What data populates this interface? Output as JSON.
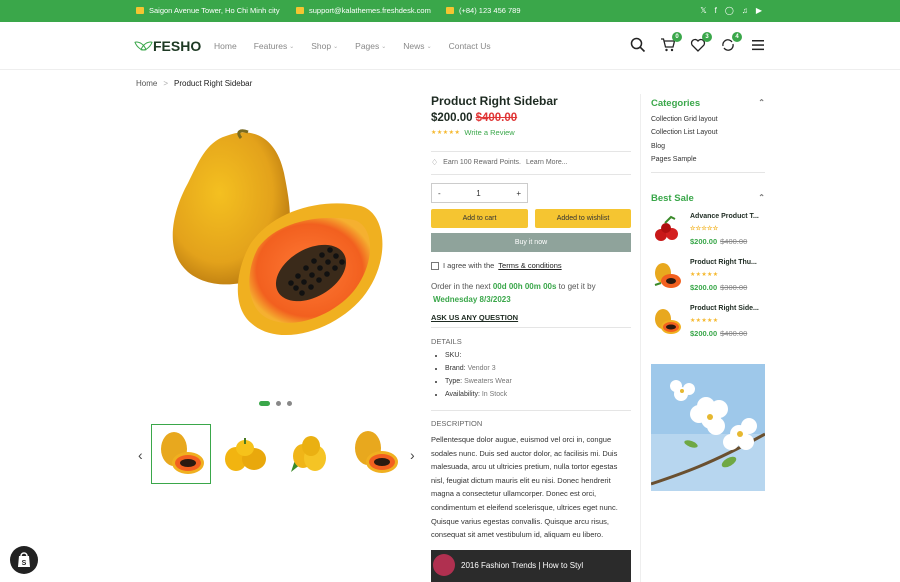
{
  "topbar": {
    "address": "Saigon Avenue Tower, Ho Chi Minh city",
    "email": "support@kalathemes.freshdesk.com",
    "phone": "(+84) 123 456 789",
    "social": [
      "twitter-icon",
      "facebook-icon",
      "instagram-icon",
      "tiktok-icon",
      "youtube-icon"
    ],
    "bg_color": "#3aa74a"
  },
  "header": {
    "logo": "FESHO",
    "nav": [
      {
        "label": "Home",
        "dropdown": false
      },
      {
        "label": "Features",
        "dropdown": true
      },
      {
        "label": "Shop",
        "dropdown": true
      },
      {
        "label": "Pages",
        "dropdown": true
      },
      {
        "label": "News",
        "dropdown": true
      },
      {
        "label": "Contact Us",
        "dropdown": false
      }
    ],
    "cart_count": "0",
    "wishlist_count": "3",
    "compare_count": "4"
  },
  "breadcrumb": {
    "home": "Home",
    "sep": ">",
    "current": "Product Right Sidebar"
  },
  "product": {
    "title": "Product Right Sidebar",
    "price": "$200.00",
    "old_price": "$400.00",
    "rating": 5,
    "review_link": "Write a Review",
    "reward": "Earn 100 Reward Points.",
    "learn_more": "Learn More...",
    "qty_minus": "-",
    "qty": "1",
    "qty_plus": "+",
    "add_to_cart": "Add to cart",
    "add_to_wishlist": "Added to wishlist",
    "buy_now": "Buy it now",
    "agree_text": "I agree with the",
    "terms": "Terms & conditions",
    "order_prefix": "Order in the next",
    "countdown": "00d 00h 00m 00s",
    "order_mid": "to get it by",
    "delivery_date": "Wednesday 8/3/2023",
    "ask": "ASK US ANY QUESTION",
    "details_title": "DETAILS",
    "details": [
      {
        "label": "SKU:",
        "value": ""
      },
      {
        "label": "Brand:",
        "value": "Vendor 3"
      },
      {
        "label": "Type:",
        "value": "Sweaters Wear"
      },
      {
        "label": "Availability:",
        "value": "In Stock"
      }
    ],
    "description_title": "DESCRIPTION",
    "description": "Pellentesque dolor augue, euismod vel orci in, congue sodales nunc. Duis sed auctor dolor, ac facilisis mi. Duis malesuada, arcu ut ultricies pretium, nulla tortor egestas nisl, feugiat dictum mauris elit eu nisi. Donec hendrerit magna a consectetur ullamcorper. Donec est orci, condimentum et eleifend scelerisque, ultrices eget nunc. Quisque varius egestas convallis. Quisque arcu risus, consequat sit amet vestibulum id, aliquam eu libero.",
    "video_title": "2016 Fashion Trends | How to Styl"
  },
  "gallery": {
    "slide_count": 3,
    "active_slide": 1,
    "thumbnails": [
      "papaya-thumb",
      "yellow-pepper-thumb",
      "lemon-thumb",
      "papaya-thumb-2"
    ]
  },
  "sidebar": {
    "categories_title": "Categories",
    "categories": [
      "Collection Grid layout",
      "Collection List Layout",
      "Blog",
      "Pages Sample"
    ],
    "best_sale_title": "Best Sale",
    "best_sale": [
      {
        "title": "Advance Product T...",
        "rating": 0,
        "price": "$200.00",
        "old_price": "$400.00"
      },
      {
        "title": "Product Right Thu...",
        "rating": 5,
        "price": "$200.00",
        "old_price": "$300.00"
      },
      {
        "title": "Product Right Side...",
        "rating": 5,
        "price": "$200.00",
        "old_price": "$400.00"
      }
    ]
  },
  "colors": {
    "accent": "#3aa74a",
    "button_yellow": "#f5c531",
    "buy_now": "#8fa39b",
    "sale_red": "#e03535"
  }
}
